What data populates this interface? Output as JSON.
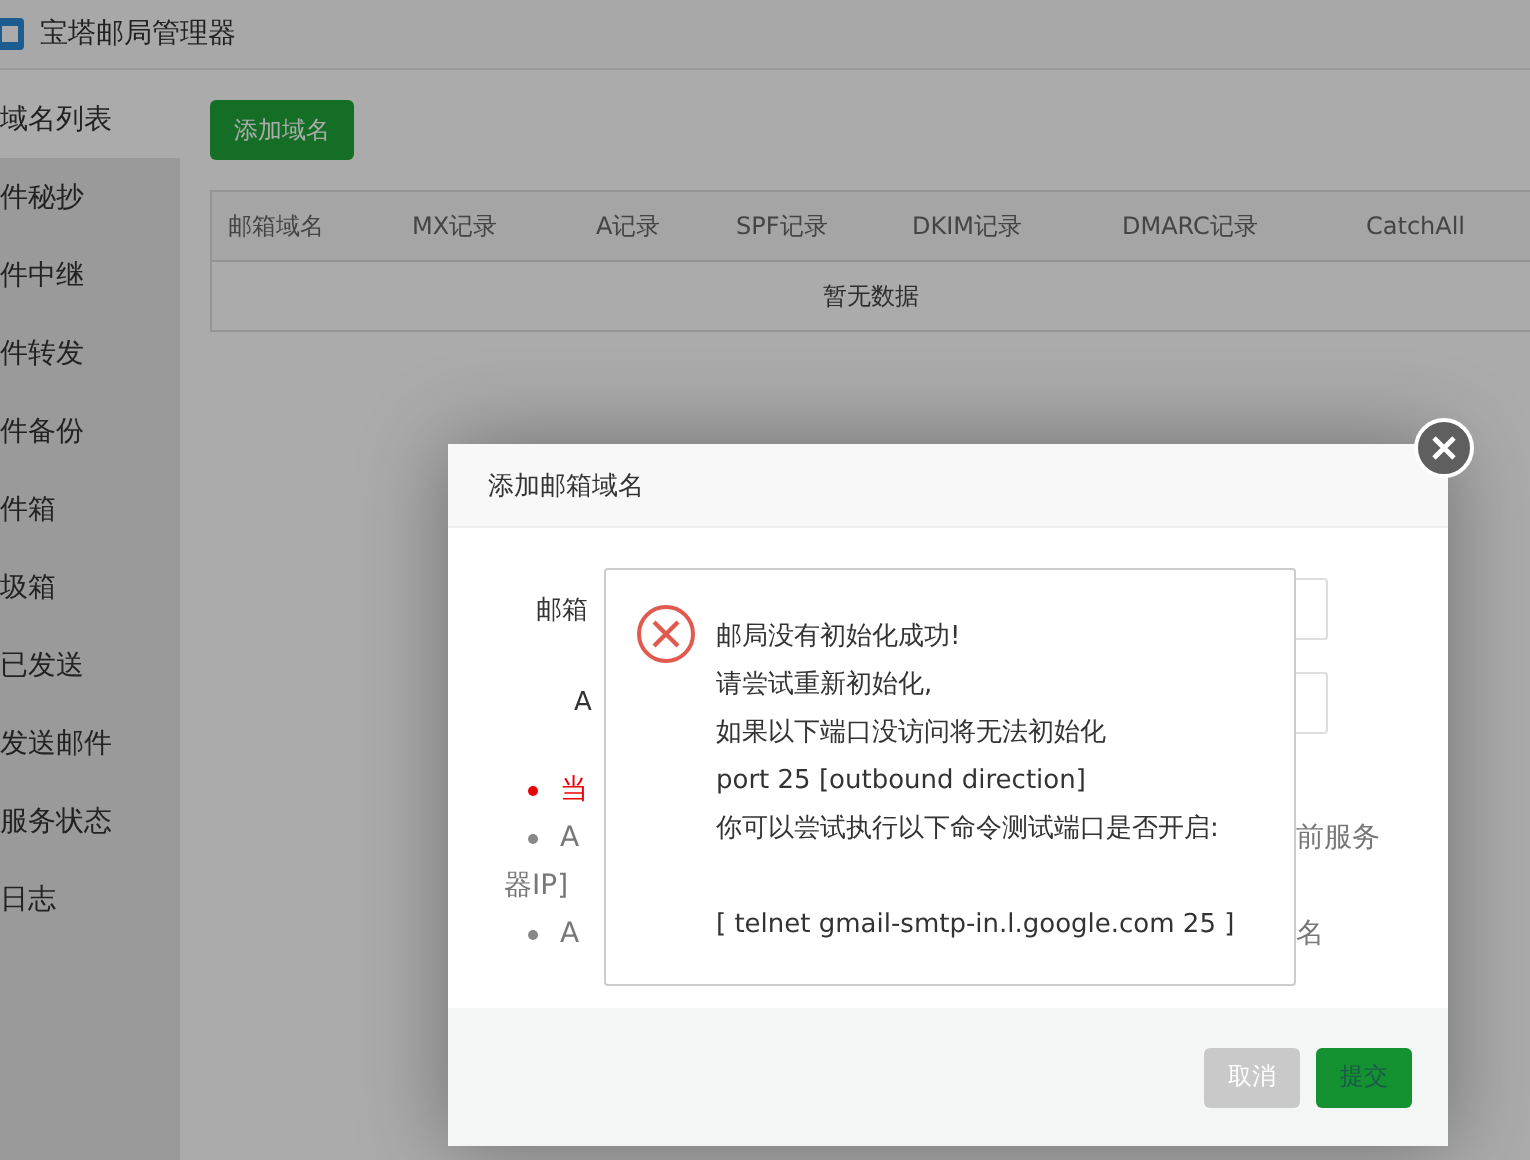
{
  "app": {
    "title": "宝塔邮局管理器"
  },
  "sidebar": {
    "items": [
      {
        "label": "域名列表",
        "selected": true
      },
      {
        "label": "件秘抄",
        "selected": false
      },
      {
        "label": "件中继",
        "selected": false
      },
      {
        "label": "件转发",
        "selected": false
      },
      {
        "label": "件备份",
        "selected": false
      },
      {
        "label": "件箱",
        "selected": false
      },
      {
        "label": "圾箱",
        "selected": false
      },
      {
        "label": "已发送",
        "selected": false
      },
      {
        "label": "发送邮件",
        "selected": false
      },
      {
        "label": "服务状态",
        "selected": false
      },
      {
        "label": "日志",
        "selected": false
      }
    ]
  },
  "toolbar": {
    "add_button": "添加域名"
  },
  "table": {
    "columns": [
      "邮箱域名",
      "MX记录",
      "A记录",
      "SPF记录",
      "DKIM记录",
      "DMARC记录",
      "CatchAll"
    ],
    "empty_text": "暂无数据"
  },
  "dialog": {
    "title": "添加邮箱域名",
    "fields": [
      {
        "label": "邮箱"
      },
      {
        "label": "A"
      }
    ],
    "notes": [
      {
        "kind": "warning",
        "left": "当"
      },
      {
        "kind": "info",
        "left": "A",
        "right": "前服务"
      },
      {
        "kind": "wrap",
        "left": "器IP]"
      },
      {
        "kind": "info",
        "left": "A",
        "right": "名"
      }
    ],
    "buttons": [
      {
        "label": "取消",
        "kind": "cancel"
      },
      {
        "label": "提交",
        "kind": "submit"
      }
    ]
  },
  "error_popup": {
    "lines": [
      "邮局没有初始化成功!",
      "请尝试重新初始化,",
      "如果以下端口没访问将无法初始化",
      "port 25 [outbound direction]",
      "你可以尝试执行以下命令测试端口是否开启:",
      "[ telnet gmail-smtp-in.l.google.com 25 ]"
    ]
  }
}
